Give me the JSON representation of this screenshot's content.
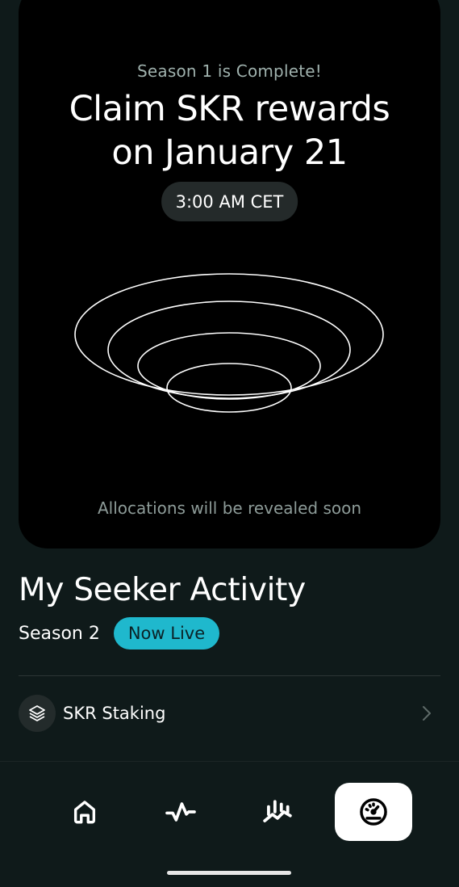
{
  "banner": {
    "season_note": "Season 1 is Complete!",
    "headline_line1": "Claim SKR rewards",
    "headline_line2": "on January 21",
    "time": "3:00 AM CET",
    "allocations_note": "Allocations will be revealed soon"
  },
  "activity": {
    "title": "My Seeker Activity",
    "season_label": "Season 2",
    "status_badge": "Now Live",
    "status_color": "#1fb8cd"
  },
  "rows": [
    {
      "label": "SKR Staking",
      "icon": "layers-icon"
    }
  ],
  "nav": {
    "items": [
      {
        "icon": "home-icon",
        "active": false
      },
      {
        "icon": "activity-pulse-icon",
        "active": false
      },
      {
        "icon": "chart-trend-icon",
        "active": false
      },
      {
        "icon": "gauge-icon",
        "active": true
      }
    ]
  }
}
